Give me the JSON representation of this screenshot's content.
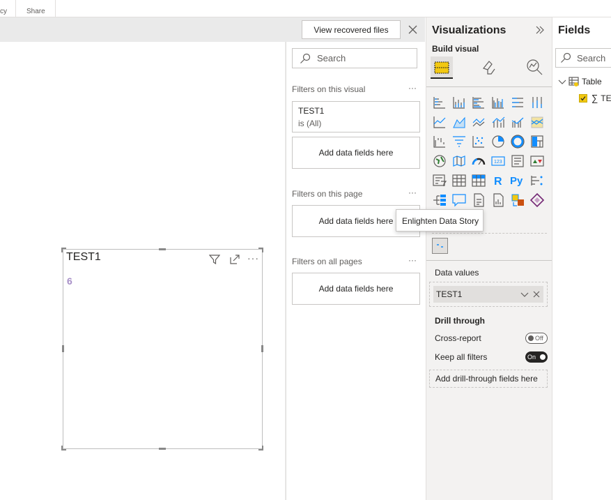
{
  "ribbon": {
    "partial_label": "cy",
    "share_label": "Share"
  },
  "recovered": {
    "button_label": "View recovered files"
  },
  "canvas": {
    "card": {
      "title": "TEST1",
      "value": "6"
    }
  },
  "filters": {
    "search_placeholder": "Search",
    "visual_section": "Filters on this visual",
    "visual_card": {
      "field": "TEST1",
      "condition": "is (All)"
    },
    "add_fields": "Add data fields here",
    "page_section": "Filters on this page",
    "all_section": "Filters on all pages",
    "more": "···"
  },
  "viz": {
    "title": "Visualizations",
    "build_visual": "Build visual",
    "tooltip": "Enlighten Data Story",
    "data_values_label": "Data values",
    "data_value_field": "TEST1",
    "drill_through": "Drill through",
    "cross_report": "Cross-report",
    "cross_report_state": "Off",
    "keep_filters": "Keep all filters",
    "keep_filters_state": "On",
    "add_drill": "Add drill-through fields here",
    "r_label": "R",
    "py_label": "Py",
    "num_label": "123"
  },
  "fields": {
    "title": "Fields",
    "search_placeholder": "Search",
    "table_name": "Table",
    "field_partial": "TE"
  },
  "colors": {
    "accent": "#118dff",
    "selected_bg": "#e1dfdd",
    "yellow": "#f2c811",
    "card_value": "#a78fc7"
  }
}
